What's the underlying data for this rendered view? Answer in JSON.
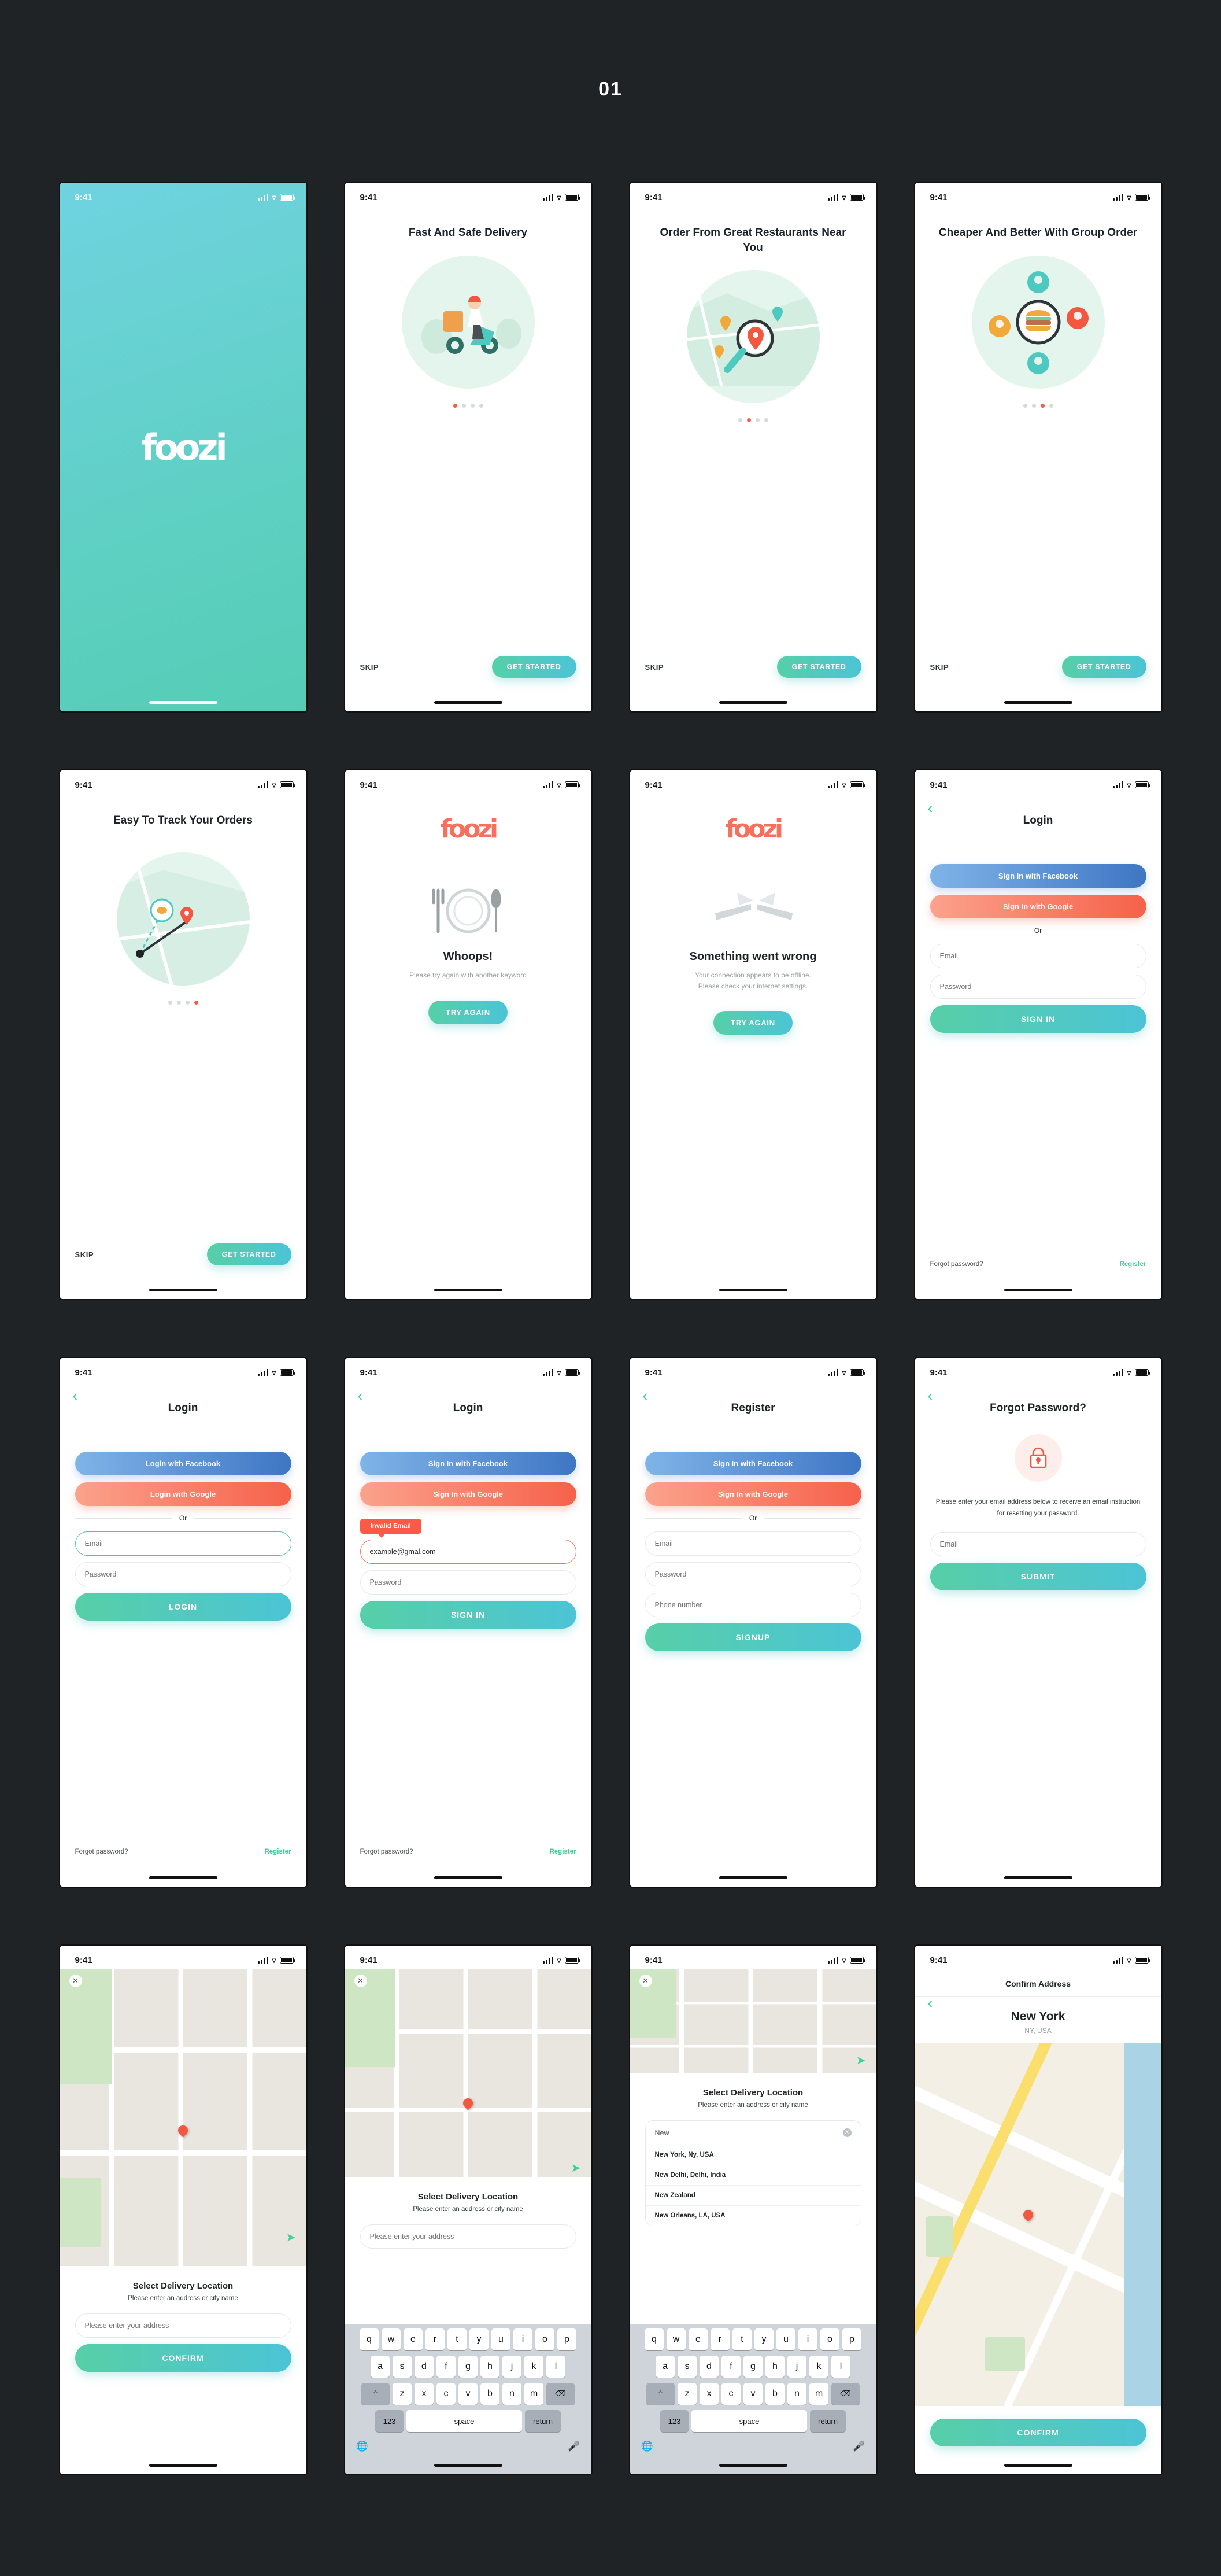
{
  "page": {
    "title": "01"
  },
  "brand": {
    "logo": "foozi",
    "accent_green": "#3bd19a",
    "accent_red": "#fb5b46",
    "gradient_start": "#57cfa7",
    "gradient_end": "#4cc4d6"
  },
  "status_bar": {
    "time": "9:41",
    "signal": "signal-bars-icon",
    "wifi": "wifi-icon",
    "battery": "battery-icon"
  },
  "screens": {
    "splash": {
      "logo": "foozi"
    },
    "onboarding": [
      {
        "title": "Fast And Safe Delivery",
        "skip": "SKIP",
        "cta": "GET STARTED",
        "dots": 4,
        "active": 0,
        "illustration": "scooter-delivery-illustration"
      },
      {
        "title": "Order From Great Restaurants Near You",
        "skip": "SKIP",
        "cta": "GET STARTED",
        "dots": 4,
        "active": 1,
        "illustration": "map-search-pin-illustration"
      },
      {
        "title": "Cheaper And Better With Group Order",
        "skip": "SKIP",
        "cta": "GET STARTED",
        "dots": 4,
        "active": 2,
        "illustration": "group-order-burger-illustration"
      },
      {
        "title": "Easy To Track Your Orders",
        "skip": "SKIP",
        "cta": "GET STARTED",
        "dots": 4,
        "active": 3,
        "illustration": "tracking-route-illustration"
      }
    ],
    "whoops": {
      "logo": "foozi",
      "title": "Whoops!",
      "subtitle": "Please try again with another keyword",
      "cta": "TRY AGAIN",
      "illustration": "fork-plate-knife-icon"
    },
    "offline": {
      "logo": "foozi",
      "title": "Something went wrong",
      "subtitle_line1": "Your connection appears to be offline.",
      "subtitle_line2": "Please check your internet settings.",
      "cta": "TRY AGAIN",
      "illustration": "broken-plate-icon"
    },
    "login_signin": {
      "title": "Login",
      "facebook": "Sign In with Facebook",
      "google": "Sign In with Google",
      "or": "Or",
      "email_placeholder": "Email",
      "password_placeholder": "Password",
      "submit": "SIGN IN",
      "forgot": "Forgot password?",
      "register": "Register"
    },
    "login_variant": {
      "title": "Login",
      "facebook": "Login with Facebook",
      "google": "Login with Google",
      "or": "Or",
      "email_placeholder": "Email",
      "password_placeholder": "Password",
      "submit": "LOGIN",
      "forgot": "Forgot password?",
      "register": "Register"
    },
    "login_error": {
      "title": "Login",
      "facebook": "Sign In with Facebook",
      "google": "Sign In with Google",
      "or": "Or",
      "error_tooltip": "Invalid Email",
      "email_value": "example@gmal.com",
      "password_placeholder": "Password",
      "submit": "SIGN IN",
      "forgot": "Forgot password?",
      "register": "Register"
    },
    "register": {
      "title": "Register",
      "facebook": "Sign In with Facebook",
      "google": "Sign In with Google",
      "or": "Or",
      "email_placeholder": "Email",
      "password_placeholder": "Password",
      "phone_placeholder": "Phone number",
      "submit": "SIGNUP"
    },
    "forgot_password": {
      "title": "Forgot Password?",
      "description": "Please enter your email address below to receive an email instruction for resetting your password.",
      "email_placeholder": "Email",
      "submit": "SUBMIT",
      "icon": "lock-icon"
    },
    "location_empty": {
      "title": "Select Delivery Location",
      "subtitle": "Please enter an address or city name",
      "address_placeholder": "Please enter your address",
      "cta": "CONFIRM"
    },
    "location_keyboard": {
      "title": "Select Delivery Location",
      "subtitle": "Please enter an address or city name",
      "address_placeholder": "Please enter your address"
    },
    "location_results": {
      "title": "Select Delivery Location",
      "subtitle": "Please enter an address or city name",
      "query": "New",
      "suggestions": [
        "New York, Ny, USA",
        "New Delhi, Delhi, India",
        "New Zealand",
        "New Orleans, LA, USA"
      ]
    },
    "confirm_address": {
      "title": "Confirm Address",
      "city": "New York",
      "region": "NY, USA",
      "cta": "CONFIRM"
    }
  },
  "keyboard": {
    "row1": [
      "q",
      "w",
      "e",
      "r",
      "t",
      "y",
      "u",
      "i",
      "o",
      "p"
    ],
    "row2": [
      "a",
      "s",
      "d",
      "f",
      "g",
      "h",
      "j",
      "k",
      "l"
    ],
    "row3": [
      "z",
      "x",
      "c",
      "v",
      "b",
      "n",
      "m"
    ],
    "shift": "⇧",
    "backspace": "⌫",
    "numbers": "123",
    "space": "space",
    "return": "return",
    "globe": "globe-icon",
    "mic": "microphone-icon"
  }
}
